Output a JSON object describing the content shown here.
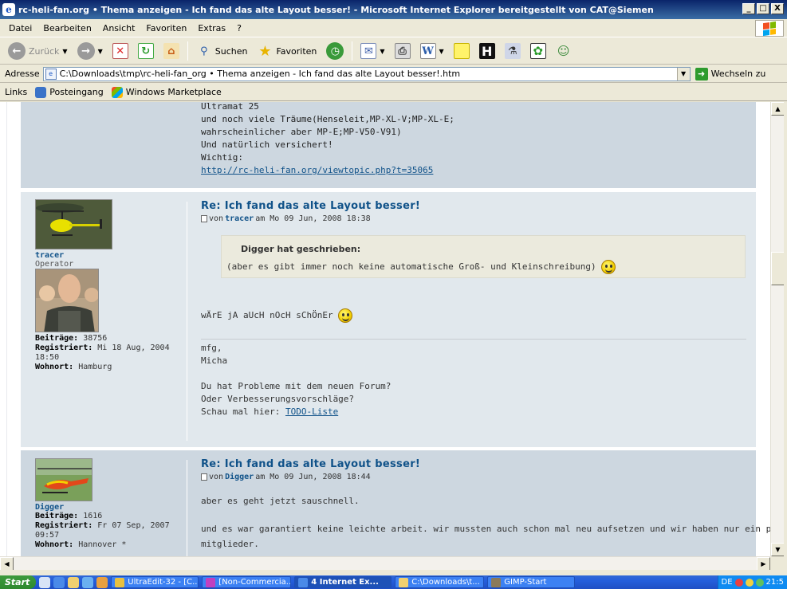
{
  "window": {
    "title": "rc-heli-fan.org • Thema anzeigen - Ich fand das alte Layout besser! - Microsoft Internet Explorer bereitgestellt von CAT@Siemen",
    "controls": [
      "_",
      "□",
      "X"
    ]
  },
  "menu": {
    "items": [
      "Datei",
      "Bearbeiten",
      "Ansicht",
      "Favoriten",
      "Extras",
      "?"
    ]
  },
  "toolbar": {
    "back_label": "Zurück",
    "search_label": "Suchen",
    "favorites_label": "Favoriten"
  },
  "address": {
    "label": "Adresse",
    "url": "C:\\Downloads\\tmp\\rc-heli-fan_org • Thema anzeigen - Ich fand das alte Layout besser!.htm",
    "go_label": "Wechseln zu"
  },
  "links": {
    "label": "Links",
    "items": [
      "Posteingang",
      "Windows Marketplace"
    ]
  },
  "top_post": {
    "lines": [
      "Ultramat 25",
      "und noch viele Träume(Henseleit,MP-XL-V;MP-XL-E;",
      "wahrscheinlicher aber MP-E;MP-V50-V91)",
      "Und natürlich versichert!",
      "Wichtig:"
    ],
    "link": "http://rc-heli-fan.org/viewtopic.php?t=35065"
  },
  "post_tracer": {
    "username": "tracer",
    "rank": "Operator",
    "posts_label": "Beiträge:",
    "posts": "38756",
    "registered_label": "Registriert:",
    "registered": "Mi 18 Aug, 2004",
    "registered_time": "18:50",
    "location_label": "Wohnort:",
    "location": "Hamburg",
    "title": "Re: Ich fand das alte Layout besser!",
    "by": "von",
    "author": "tracer",
    "date": "am Mo 09 Jun, 2008 18:38",
    "quote_cite": "Digger hat geschrieben:",
    "quote_text": "(aber es gibt immer noch keine automatische Groß- und Kleinschreibung)",
    "body": "wÄrE jA aUcH nOcH sChÖnEr",
    "signature": [
      "mfg,",
      "Micha",
      "",
      "Du hat Probleme mit dem neuen Forum?",
      "Oder Verbesserungsvorschläge?"
    ],
    "sig_link_prefix": "Schau mal hier:",
    "sig_link": "TODO-Liste"
  },
  "post_digger": {
    "username": "Digger",
    "posts_label": "Beiträge:",
    "posts": "1616",
    "registered_label": "Registriert:",
    "registered": "Fr 07 Sep, 2007",
    "registered_time": "09:57",
    "location_label": "Wohnort:",
    "location": "Hannover *",
    "title": "Re: Ich fand das alte Layout besser!",
    "by": "von",
    "author": "Digger",
    "date": "am Mo 09 Jun, 2008 18:44",
    "body_1": "aber es geht jetzt sauschnell.",
    "body_2": "und es war garantiert keine leichte arbeit. wir mussten auch schon mal neu aufsetzen und wir haben nur ein paar",
    "body_3": "mitglieder."
  },
  "taskbar": {
    "start": "Start",
    "tasks": [
      "UltraEdit-32 - [C...",
      "[Non-Commercia...",
      "4 Internet Ex...",
      "C:\\Downloads\\t...",
      "GIMP-Start"
    ],
    "lang": "DE",
    "clock": "21:5"
  }
}
